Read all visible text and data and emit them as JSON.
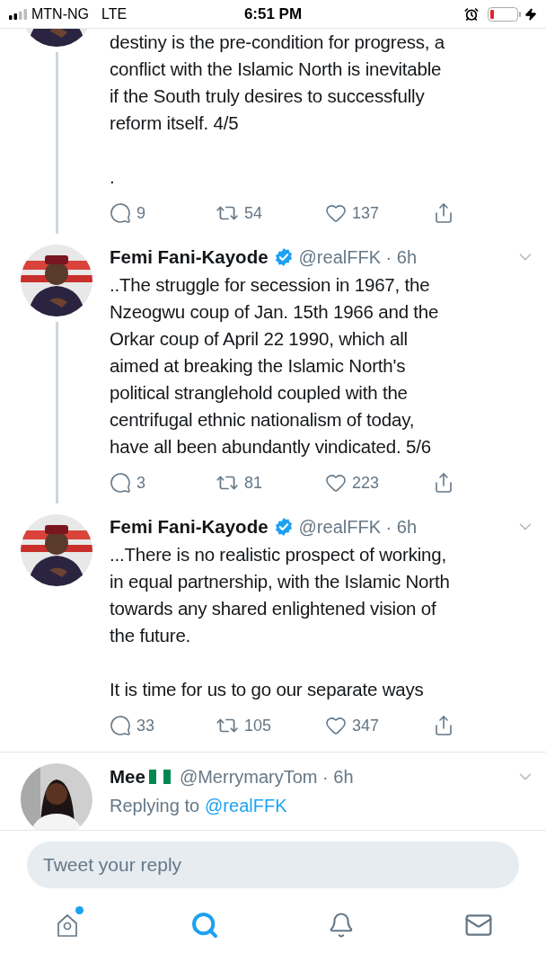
{
  "status_bar": {
    "carrier": "MTN-NG",
    "network": "LTE",
    "time": "6:51 PM"
  },
  "tweets": [
    {
      "partial": true,
      "text": "destiny is the pre-condition for progress, a\nconflict with the Islamic North is inevitable\nif the South truly desires to successfully\nreform itself. 4/5\n\n.",
      "replies": "9",
      "retweets": "54",
      "likes": "137",
      "thread": true
    },
    {
      "partial": false,
      "name": "Femi Fani-Kayode",
      "verified": true,
      "handle": "@realFFK",
      "separator": "·",
      "time": "6h",
      "text": "..The struggle for secession in 1967, the\nNzeogwu coup of Jan. 15th 1966 and the\nOrkar coup of April 22 1990, which all\naimed at breaking the Islamic North's\npolitical stranglehold coupled with the\ncentrifugal ethnic nationalism of today,\nhave all been abundantly vindicated. 5/6",
      "replies": "3",
      "retweets": "81",
      "likes": "223",
      "thread": true
    },
    {
      "partial": false,
      "name": "Femi Fani-Kayode",
      "verified": true,
      "handle": "@realFFK",
      "separator": "·",
      "time": "6h",
      "text": "...There is no realistic prospect of working,\nin equal partnership, with the Islamic North\ntowards any shared enlightened vision of\nthe future.\n\nIt is time for us to go our separate ways",
      "replies": "33",
      "retweets": "105",
      "likes": "347",
      "thread": false
    }
  ],
  "reply_tweet": {
    "name": "Mee",
    "handle": "@MerrymaryTom",
    "separator": "·",
    "time": "6h",
    "replying_label": "Replying to",
    "replying_to": "@realFFK"
  },
  "reply_field": {
    "placeholder": "Tweet your reply"
  },
  "tab_bar": [
    {
      "kind": "home",
      "selected": false,
      "badge": true
    },
    {
      "kind": "search",
      "selected": true,
      "badge": false
    },
    {
      "kind": "notifications",
      "selected": false,
      "badge": false
    },
    {
      "kind": "messages",
      "selected": false,
      "badge": false
    }
  ]
}
